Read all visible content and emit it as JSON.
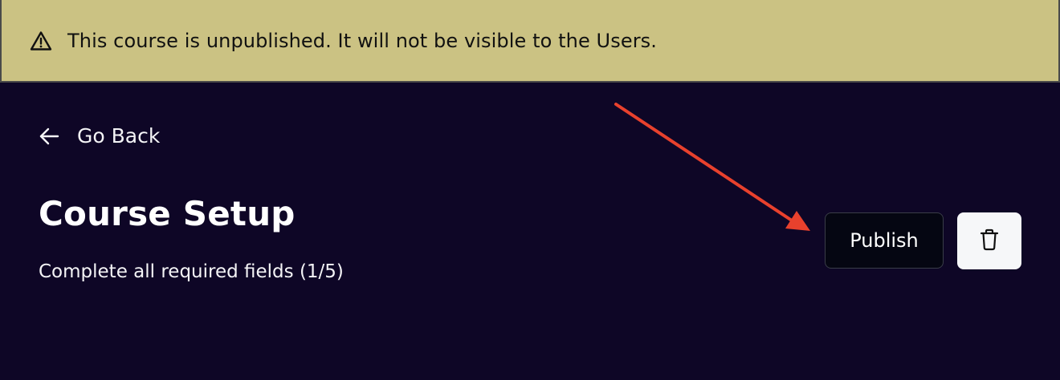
{
  "banner": {
    "icon": "warning-triangle-icon",
    "message": "This course is unpublished. It will not be visible to the Users."
  },
  "navigation": {
    "back_icon": "arrow-left-icon",
    "back_label": "Go Back"
  },
  "header": {
    "title": "Course Setup",
    "subtitle": "Complete all required fields (1/5)"
  },
  "actions": {
    "publish_label": "Publish",
    "delete_icon": "trash-icon"
  },
  "colors": {
    "banner_background": "#cbc283",
    "page_background": "#0e0626",
    "publish_background": "#050612",
    "delete_background": "#f6f7f9",
    "annotation_arrow": "#e8412d"
  }
}
